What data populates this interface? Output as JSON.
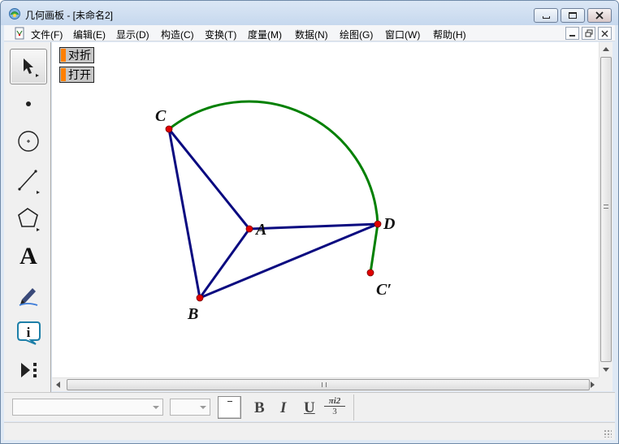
{
  "window": {
    "title": "几何画板 - [未命名2]",
    "caption_buttons": [
      "minimize",
      "maximize",
      "close"
    ]
  },
  "menu": {
    "items": [
      {
        "id": "file",
        "label": "文件(F)"
      },
      {
        "id": "edit",
        "label": "编辑(E)"
      },
      {
        "id": "display",
        "label": "显示(D)"
      },
      {
        "id": "construct",
        "label": "构造(C)"
      },
      {
        "id": "transform",
        "label": "变换(T)"
      },
      {
        "id": "measure",
        "label": "度量(M)"
      },
      {
        "id": "data",
        "label": "数据(N)"
      },
      {
        "id": "graph",
        "label": "绘图(G)"
      },
      {
        "id": "window",
        "label": "窗口(W)"
      },
      {
        "id": "help",
        "label": "帮助(H)"
      }
    ]
  },
  "toolbox": {
    "active_tool": "selection-arrow",
    "tools": [
      {
        "id": "selection-arrow",
        "icon": "arrow-icon"
      },
      {
        "id": "point",
        "icon": "point-icon"
      },
      {
        "id": "compass",
        "icon": "circle-icon"
      },
      {
        "id": "straightedge",
        "icon": "segment-icon"
      },
      {
        "id": "polygon",
        "icon": "polygon-icon"
      },
      {
        "id": "text",
        "icon": "text-icon",
        "glyph": "A"
      },
      {
        "id": "marker",
        "icon": "marker-pen-icon"
      },
      {
        "id": "information",
        "icon": "info-icon"
      },
      {
        "id": "custom",
        "icon": "custom-tool-icon"
      }
    ]
  },
  "canvas": {
    "action_buttons": [
      {
        "id": "fold",
        "label": "对折"
      },
      {
        "id": "open",
        "label": "打开"
      }
    ],
    "point_labels": {
      "A": "A",
      "B": "B",
      "C": "C",
      "D": "D",
      "C_prime": "C′"
    },
    "colors": {
      "segments": "#0a0a80",
      "arc": "#008000",
      "points": "#e00000",
      "action_button_marker": "#ff7f00"
    }
  },
  "text_toolbar": {
    "font_family_value": "",
    "font_size_value": "",
    "bold": "B",
    "italic": "I",
    "underline": "U",
    "math_format_numerator": "πi2",
    "math_format_denominator": "3"
  },
  "statusbar": {
    "text": ""
  }
}
